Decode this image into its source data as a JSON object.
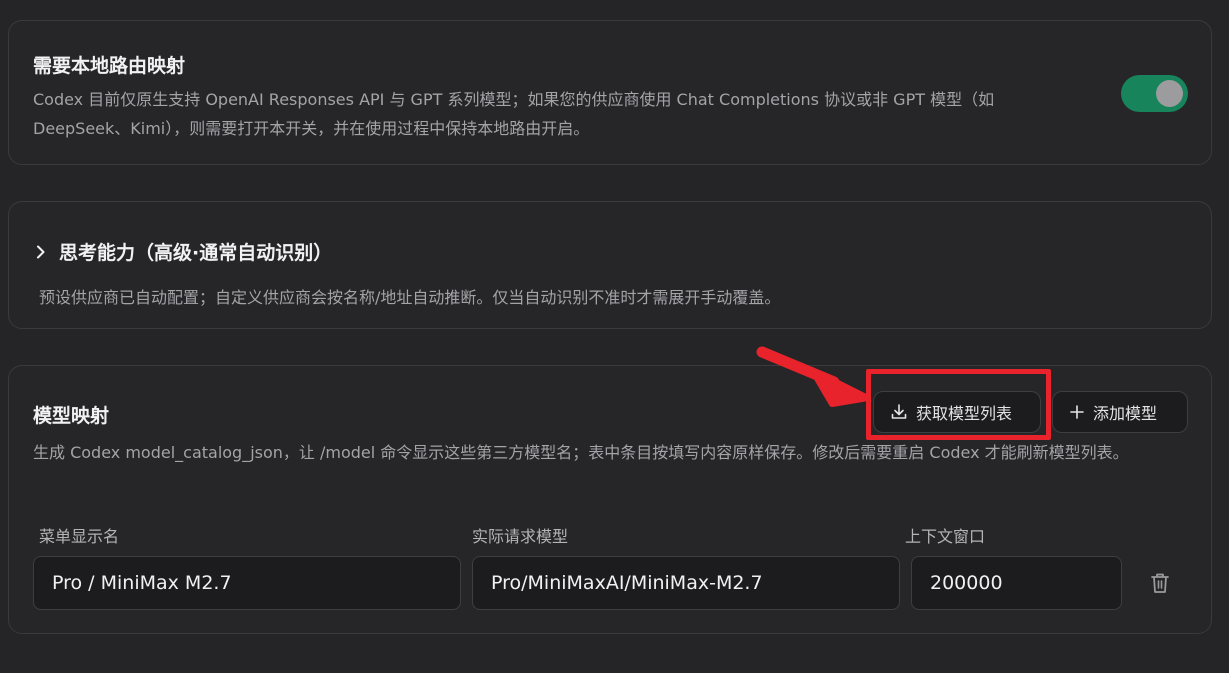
{
  "routing": {
    "title": "需要本地路由映射",
    "description": "Codex 目前仅原生支持 OpenAI Responses API 与 GPT 系列模型；如果您的供应商使用 Chat Completions 协议或非 GPT 模型（如 DeepSeek、Kimi），则需要打开本开关，并在使用过程中保持本地路由开启。",
    "toggle_on": true
  },
  "thinking": {
    "title": "思考能力（高级·通常自动识别）",
    "description": "预设供应商已自动配置；自定义供应商会按名称/地址自动推断。仅当自动识别不准时才需展开手动覆盖。",
    "expand_icon": "chevron-right-icon"
  },
  "mapping": {
    "title": "模型映射",
    "fetch_button": "获取模型列表",
    "fetch_icon": "download-icon",
    "add_button": "添加模型",
    "add_icon": "plus-icon",
    "description": "生成 Codex model_catalog_json，让 /model 命令显示这些第三方模型名；表中条目按填写内容原样保存。修改后需要重启 Codex 才能刷新模型列表。",
    "columns": {
      "display_name": "菜单显示名",
      "request_model": "实际请求模型",
      "context_window": "上下文窗口"
    },
    "rows": [
      {
        "display_name": "Pro / MiniMax M2.7",
        "request_model": "Pro/MiniMaxAI/MiniMax-M2.7",
        "context_window": "200000",
        "delete_icon": "trash-icon"
      }
    ]
  },
  "annotation": {
    "highlight_color": "#e8232b"
  },
  "colors": {
    "background": "#252528",
    "toggle_on": "#17845b"
  }
}
